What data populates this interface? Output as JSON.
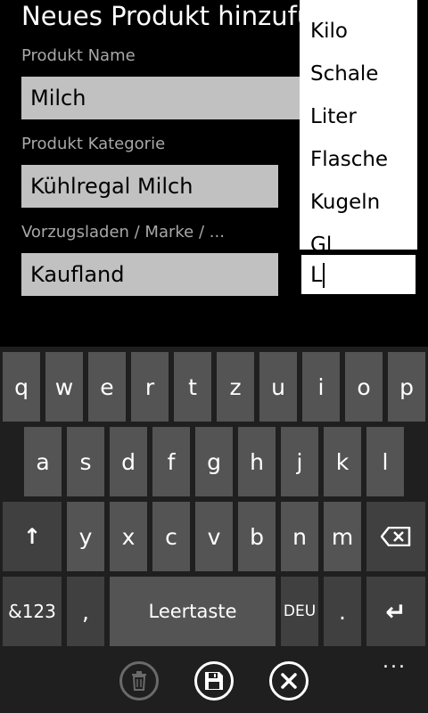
{
  "page": {
    "title": "Neues Produkt hinzufü",
    "name_label": "Produkt Name",
    "name_value": "Milch",
    "category_label": "Produkt Kategorie",
    "category_value": "Kühlregal Milch",
    "store_label": "Vorzugsladen / Marke / ...",
    "store_value": "Kaufland"
  },
  "dropdown": {
    "items": [
      "Kilo",
      "Schale",
      "Liter",
      "Flasche",
      "Kugeln",
      "Gl"
    ]
  },
  "unit_input": {
    "value": "L"
  },
  "keyboard": {
    "row1": [
      "q",
      "w",
      "e",
      "r",
      "t",
      "z",
      "u",
      "i",
      "o",
      "p"
    ],
    "row2": [
      "a",
      "s",
      "d",
      "f",
      "g",
      "h",
      "j",
      "k",
      "l"
    ],
    "row3": [
      "y",
      "x",
      "c",
      "v",
      "b",
      "n",
      "m"
    ],
    "shift_icon": "↑",
    "backspace_icon": "backspace-icon",
    "symbols_label": "&123",
    "comma_label": ",",
    "space_label": "Leertaste",
    "lang_label": "DEU",
    "period_label": ".",
    "enter_icon": "↵"
  },
  "appbar": {
    "more_label": "...",
    "buttons": [
      "delete-icon",
      "save-icon",
      "cancel-icon"
    ]
  }
}
